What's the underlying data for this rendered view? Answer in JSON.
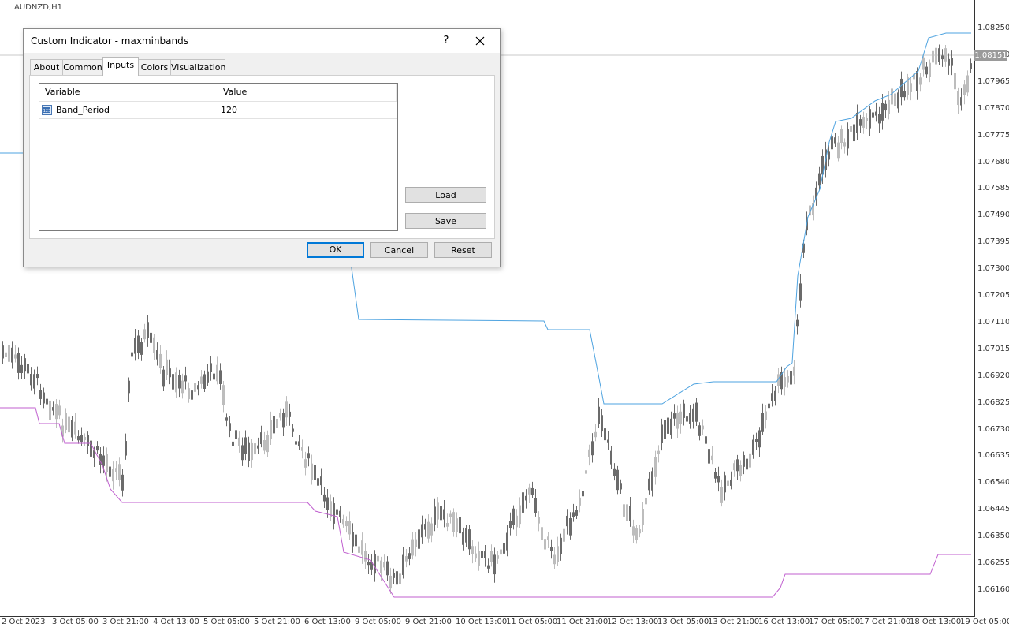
{
  "chart": {
    "symbol": "AUDNZD,H1",
    "current_price": "1.08151",
    "price_ticks": [
      "1.08250",
      "1.08060",
      "1.07965",
      "1.07870",
      "1.07775",
      "1.07680",
      "1.07585",
      "1.07490",
      "1.07395",
      "1.07300",
      "1.07205",
      "1.07110",
      "1.07015",
      "1.06920",
      "1.06825",
      "1.06730",
      "1.06635",
      "1.06540",
      "1.06445",
      "1.06350",
      "1.06255",
      "1.06160"
    ],
    "time_ticks": [
      "2 Oct 2023",
      "3 Oct 05:00",
      "3 Oct 21:00",
      "4 Oct 13:00",
      "5 Oct 05:00",
      "5 Oct 21:00",
      "6 Oct 13:00",
      "9 Oct 05:00",
      "9 Oct 21:00",
      "10 Oct 13:00",
      "11 Oct 05:00",
      "11 Oct 21:00",
      "12 Oct 13:00",
      "13 Oct 05:00",
      "13 Oct 21:00",
      "16 Oct 13:00",
      "17 Oct 05:00",
      "17 Oct 21:00",
      "18 Oct 13:00",
      "19 Oct 05:00"
    ],
    "colors": {
      "upper_band": "#4ea3e0",
      "lower_band": "#c05fcf",
      "candle_dark": "#6b6b6b",
      "candle_light": "#bdbdbd"
    }
  },
  "dialog": {
    "title": "Custom Indicator - maxminbands",
    "help": "?",
    "tabs": [
      {
        "label": "About"
      },
      {
        "label": "Common"
      },
      {
        "label": "Inputs"
      },
      {
        "label": "Colors"
      },
      {
        "label": "Visualization"
      }
    ],
    "active_tab": "Inputs",
    "grid": {
      "headers": [
        "Variable",
        "Value"
      ],
      "rows": [
        {
          "variable": "Band_Period",
          "value": "120",
          "icon": "integer-type-icon"
        }
      ]
    },
    "buttons": {
      "load": "Load",
      "save": "Save",
      "ok": "OK",
      "cancel": "Cancel",
      "reset": "Reset"
    }
  }
}
